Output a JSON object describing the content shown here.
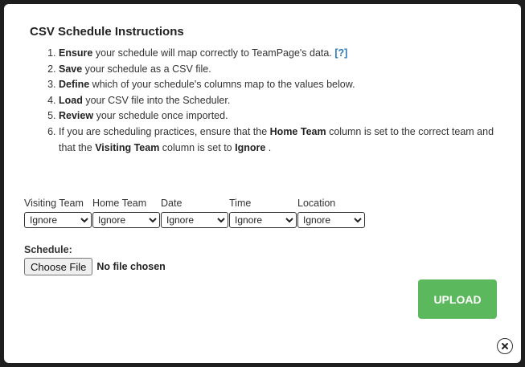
{
  "modal": {
    "title": "CSV Schedule Instructions"
  },
  "instructions": [
    {
      "bold": "Ensure",
      "text": " your schedule will map correctly to TeamPage's data. ",
      "link": "[?]"
    },
    {
      "bold": "Save",
      "text": " your schedule as a CSV file."
    },
    {
      "bold": "Define",
      "text": " which of your schedule's columns map to the values below."
    },
    {
      "bold": "Load",
      "text": " your CSV file into the Scheduler."
    },
    {
      "bold": "Review",
      "text": " your schedule once imported."
    },
    {
      "text_a": "If you are scheduling practices, ensure that the ",
      "bold_a": "Home Team",
      "text_b": " column is set to the correct team and that the ",
      "bold_b": "Visiting Team",
      "text_c": " column is set to ",
      "bold_c": "Ignore",
      "text_d": " ."
    }
  ],
  "mapping": {
    "columns": [
      {
        "label": "Visiting Team",
        "selected": "Ignore"
      },
      {
        "label": "Home Team",
        "selected": "Ignore"
      },
      {
        "label": "Date",
        "selected": "Ignore"
      },
      {
        "label": "Time",
        "selected": "Ignore"
      },
      {
        "label": "Location",
        "selected": "Ignore"
      }
    ]
  },
  "schedule": {
    "label": "Schedule:",
    "choose_button": "Choose File",
    "file_status": "No file chosen"
  },
  "upload_button": "UPLOAD",
  "icons": {
    "close": "close-icon"
  },
  "colors": {
    "upload_bg": "#5cb85c",
    "help_link": "#2a7ab8",
    "backdrop": "#1e1e1e"
  }
}
